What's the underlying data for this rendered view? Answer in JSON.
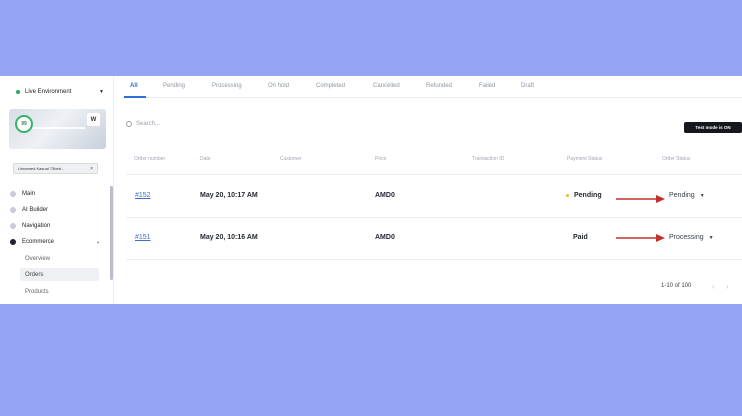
{
  "sidebar": {
    "environment": "Live Environment",
    "score": "99",
    "store_chip": "Unnamed Kasual 73beb...",
    "nav": [
      {
        "label": "Main"
      },
      {
        "label": "AI Builder"
      },
      {
        "label": "Navigation"
      },
      {
        "label": "Ecommerce"
      }
    ],
    "sub": [
      {
        "label": "Overview"
      },
      {
        "label": "Orders"
      },
      {
        "label": "Products"
      }
    ]
  },
  "tabs": [
    "All",
    "Pending",
    "Processing",
    "On hold",
    "Completed",
    "Cancelled",
    "Refunded",
    "Failed",
    "Draft"
  ],
  "search": {
    "placeholder": "Search..."
  },
  "test_mode": "Test mode is ON",
  "table": {
    "headers": [
      "Order number",
      "Date",
      "Customer",
      "Price",
      "Transaction ID",
      "Payment Status",
      "Order Status"
    ],
    "rows": [
      {
        "order": "#152",
        "date": "May 20, 10:17 AM",
        "price": "AMD0",
        "payment": "Pending",
        "status": "Pending"
      },
      {
        "order": "#151",
        "date": "May 20, 10:16 AM",
        "price": "AMD0",
        "payment": "Paid",
        "status": "Processing"
      }
    ]
  },
  "pagination": {
    "range": "1-10 of 100"
  },
  "colors": {
    "background": "#95a5f4",
    "accent": "#2f6fd6",
    "annotation_arrow": "#c0302b"
  }
}
